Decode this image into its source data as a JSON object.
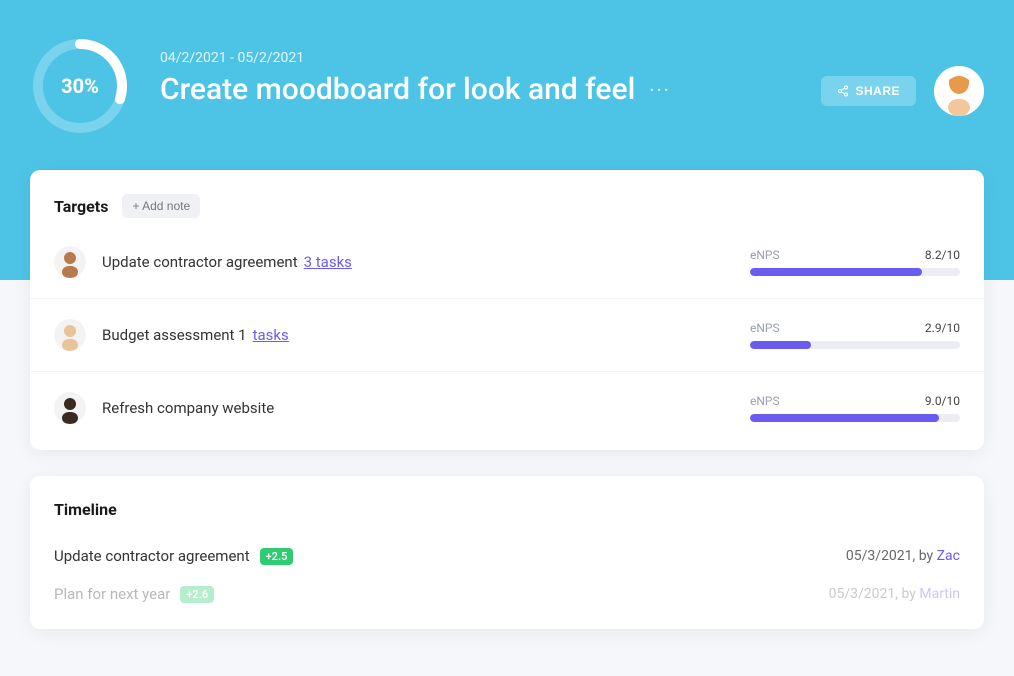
{
  "header": {
    "progress_pct": 30,
    "progress_label": "30%",
    "date_range": "04/2/2021 - 05/2/2021",
    "title": "Create moodboard for look and feel",
    "share_label": "SHARE"
  },
  "targets": {
    "heading": "Targets",
    "add_note_label": "+ Add note",
    "metric_label": "eNPS",
    "items": [
      {
        "title": "Update contractor agreement",
        "tasks_label": "3 tasks",
        "score_text": "8.2/10",
        "pct": 82,
        "has_tasks": true
      },
      {
        "title": "Budget assessment 1",
        "tasks_label": "tasks",
        "score_text": "2.9/10",
        "pct": 29,
        "has_tasks": true
      },
      {
        "title": "Refresh company website",
        "tasks_label": "",
        "score_text": "9.0/10",
        "pct": 90,
        "has_tasks": false
      }
    ],
    "avatar_colors": [
      "#b87a4a",
      "#e8c49a",
      "#3a2a22"
    ]
  },
  "timeline": {
    "heading": "Timeline",
    "by_label": "by",
    "items": [
      {
        "title": "Update contractor agreement",
        "delta": "+2.5",
        "date": "05/3/2021",
        "author": "Zac",
        "faded": false
      },
      {
        "title": "Plan for next year",
        "delta": "+2.6",
        "date": "05/3/2021",
        "author": "Martin",
        "faded": true
      }
    ]
  },
  "colors": {
    "accent": "#6a5cf0",
    "hero": "#4dc4e6",
    "success": "#2ecc71"
  }
}
